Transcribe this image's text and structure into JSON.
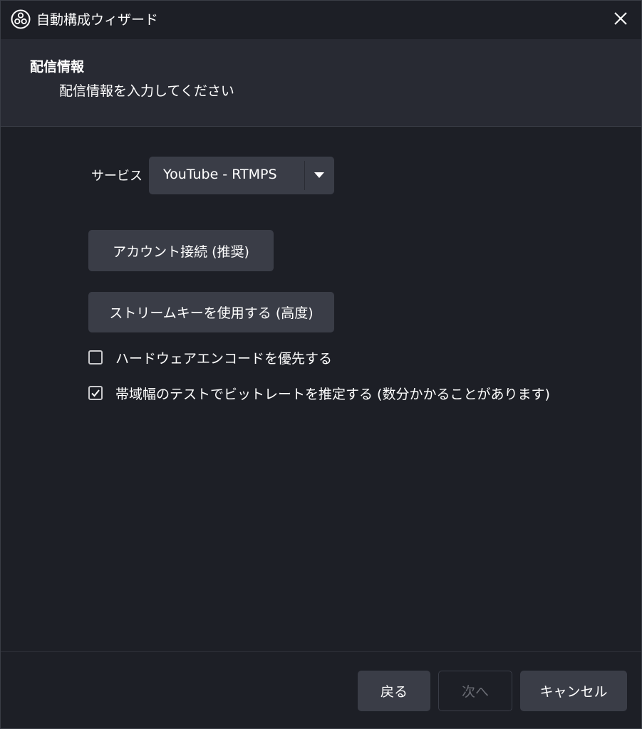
{
  "window": {
    "title": "自動構成ウィザード",
    "app_icon": "obs-logo-icon",
    "close_icon": "close-icon"
  },
  "header": {
    "title": "配信情報",
    "subtitle": "配信情報を入力してください"
  },
  "service": {
    "label": "サービス",
    "selected": "YouTube - RTMPS",
    "arrow_icon": "chevron-down-icon"
  },
  "buttons": {
    "connect_account": "アカウント接続 (推奨)",
    "use_stream_key": "ストリームキーを使用する (高度)"
  },
  "options": {
    "prefer_hardware": {
      "label": "ハードウェアエンコードを優先する",
      "checked": false
    },
    "bandwidth_test": {
      "label": "帯域幅のテストでビットレートを推定する (数分かかることがあります)",
      "checked": true
    }
  },
  "footer": {
    "back_label": "戻る",
    "next_label": "次へ",
    "next_enabled": false,
    "cancel_label": "キャンセル"
  },
  "colors": {
    "background": "#1d1f26",
    "header_background": "#282a33",
    "button": "#3a3d47",
    "text": "#ffffff",
    "disabled_text": "#6a6c74"
  }
}
